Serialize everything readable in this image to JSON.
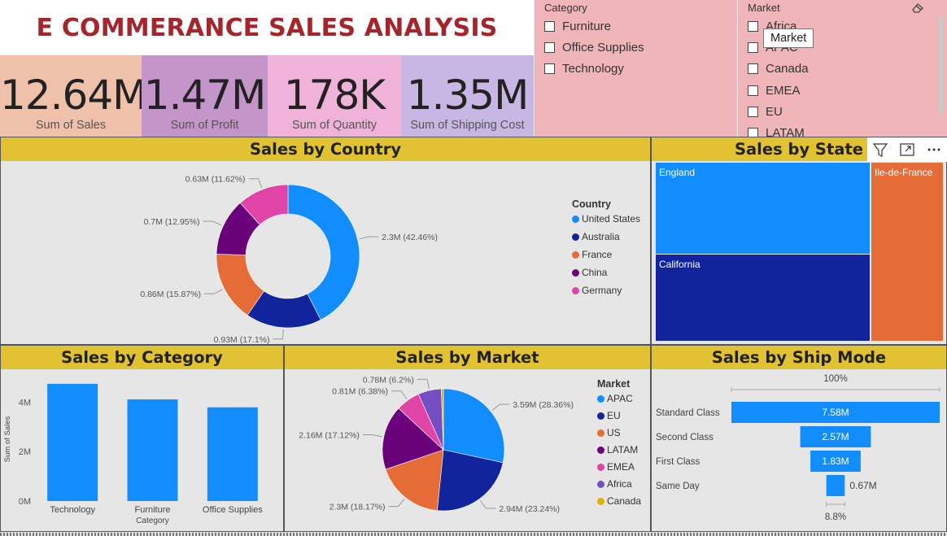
{
  "title": "E COMMERANCE SALES ANALYSIS",
  "kpis": [
    {
      "value": "12.64M",
      "label": "Sum of Sales",
      "color": "#f0c1aa"
    },
    {
      "value": "1.47M",
      "label": "Sum of Profit",
      "color": "#c395c8"
    },
    {
      "value": "178K",
      "label": "Sum of Quantity",
      "color": "#efb2d8"
    },
    {
      "value": "1.35M",
      "label": "Sum of Shipping Cost",
      "color": "#c8b6e4"
    }
  ],
  "category_slicer": {
    "header": "Category",
    "items": [
      "Furniture",
      "Office Supplies",
      "Technology"
    ]
  },
  "market_slicer": {
    "header": "Market",
    "items": [
      "Africa",
      "APAC",
      "Canada",
      "EMEA",
      "EU",
      "LATAM"
    ],
    "tooltip": "Market"
  },
  "colors": {
    "blue": "#118dff",
    "navy": "#12239e",
    "orange": "#e66c37",
    "purple": "#6b007b",
    "pink": "#e044a7",
    "violet": "#744ec2",
    "gold": "#d9b300",
    "header": "#e1c233"
  },
  "chart_data": [
    {
      "type": "pie",
      "variant": "donut",
      "title": "Sales by Country",
      "legend_title": "Country",
      "categories": [
        "United States",
        "Australia",
        "France",
        "China",
        "Germany"
      ],
      "values": [
        2.3,
        0.93,
        0.86,
        0.7,
        0.63
      ],
      "percents": [
        42.46,
        17.1,
        15.87,
        12.95,
        11.62
      ],
      "labels": [
        "2.3M (42.46%)",
        "0.93M (17.1%)",
        "0.86M (15.87%)",
        "0.7M (12.95%)",
        "0.63M (11.62%)"
      ],
      "colors": [
        "#118dff",
        "#12239e",
        "#e66c37",
        "#6b007b",
        "#e044a7"
      ],
      "legend_position": "right"
    },
    {
      "type": "treemap",
      "title": "Sales by State",
      "categories": [
        "England",
        "California",
        "Ile-de-France"
      ],
      "colors": [
        "#118dff",
        "#12239e",
        "#e66c37"
      ]
    },
    {
      "type": "bar",
      "title": "Sales by Category",
      "categories": [
        "Technology",
        "Furniture",
        "Office Supplies"
      ],
      "values": [
        4.74,
        4.11,
        3.79
      ],
      "ylabel": "Sum of Sales",
      "xlabel": "Category",
      "yticks": [
        "0M",
        "2M",
        "4M"
      ],
      "ylim": [
        0,
        5
      ],
      "color": "#118dff"
    },
    {
      "type": "pie",
      "title": "Sales by Market",
      "legend_title": "Market",
      "categories": [
        "APAC",
        "EU",
        "US",
        "LATAM",
        "EMEA",
        "Africa",
        "Canada"
      ],
      "values": [
        3.59,
        2.94,
        2.3,
        2.16,
        0.81,
        0.78,
        0.07
      ],
      "percents": [
        28.36,
        23.24,
        18.17,
        17.12,
        6.38,
        6.2,
        0.53
      ],
      "labels": [
        "3.59M (28.36%)",
        "2.94M (23.24%)",
        "2.3M (18.17%)",
        "2.16M (17.12%)",
        "0.81M (6.38%)",
        "0.78M (6.2%)",
        ""
      ],
      "colors": [
        "#118dff",
        "#12239e",
        "#e66c37",
        "#6b007b",
        "#e044a7",
        "#744ec2",
        "#d9b300"
      ],
      "legend_position": "right"
    },
    {
      "type": "funnel",
      "title": "Sales by Ship Mode",
      "categories": [
        "Standard Class",
        "Second Class",
        "First Class",
        "Same Day"
      ],
      "values": [
        7.58,
        2.57,
        1.83,
        0.67
      ],
      "labels": [
        "7.58M",
        "2.57M",
        "1.83M",
        "0.67M"
      ],
      "top_percent": "100%",
      "bottom_percent": "8.8%",
      "color": "#118dff"
    }
  ]
}
